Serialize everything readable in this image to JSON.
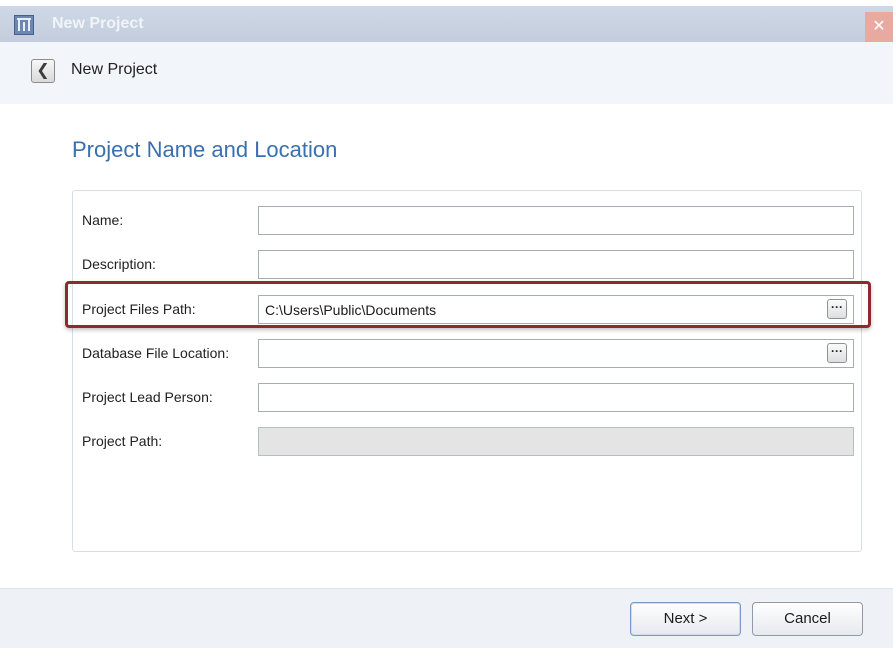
{
  "window": {
    "title": "New Project",
    "close_glyph": "✕",
    "icon": "app-chart-icon"
  },
  "nav": {
    "back_glyph": "❮",
    "title": "New Project"
  },
  "section": {
    "title": "Project Name and Location"
  },
  "form": {
    "name": {
      "label": "Name:",
      "value": ""
    },
    "description": {
      "label": "Description:",
      "value": ""
    },
    "project_files_path": {
      "label": "Project Files Path:",
      "value": "C:\\Users\\Public\\Documents",
      "browse_glyph": "···"
    },
    "database_file_location": {
      "label": "Database File Location:",
      "value": "",
      "browse_glyph": "···"
    },
    "project_lead_person": {
      "label": "Project Lead Person:",
      "value": ""
    },
    "project_path": {
      "label": "Project Path:",
      "value": ""
    }
  },
  "footer": {
    "next_label": "Next >",
    "cancel_label": "Cancel"
  },
  "colors": {
    "accent": "#3a6fb0",
    "highlight": "#8d2a2d"
  }
}
